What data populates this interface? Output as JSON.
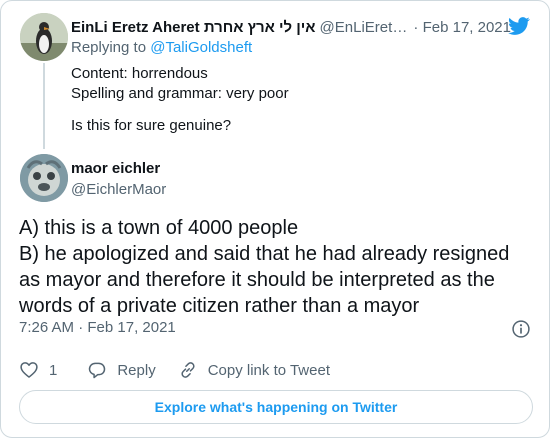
{
  "parent_tweet": {
    "author_name": "EinLi Eretz Aheret אין לי ארץ אחרת",
    "handle": "@EnLiEretz...",
    "date": "· Feb 17, 2021",
    "replying_label": "Replying to",
    "replying_to": "@TaliGoldsheft",
    "text_lines": [
      "Content: horrendous",
      "Spelling and grammar: very poor",
      "",
      "Is this for sure genuine?"
    ]
  },
  "main_tweet": {
    "author_name": "maor eichler",
    "handle": "@EichlerMaor",
    "text_lines": [
      "A) this is a town of 4000 people",
      "B) he apologized and said that he had already resigned",
      "as mayor and therefore it should be interpreted as the",
      "words of a private citizen rather than a mayor"
    ],
    "timestamp": "7:26 AM · Feb 17, 2021"
  },
  "actions": {
    "like_count": "1",
    "reply_label": "Reply",
    "copy_link_label": "Copy link to Tweet"
  },
  "explore_label": "Explore what's happening on Twitter",
  "colors": {
    "accent": "#1d9bf0",
    "secondary_text": "#536471",
    "border": "#cfd9de"
  }
}
